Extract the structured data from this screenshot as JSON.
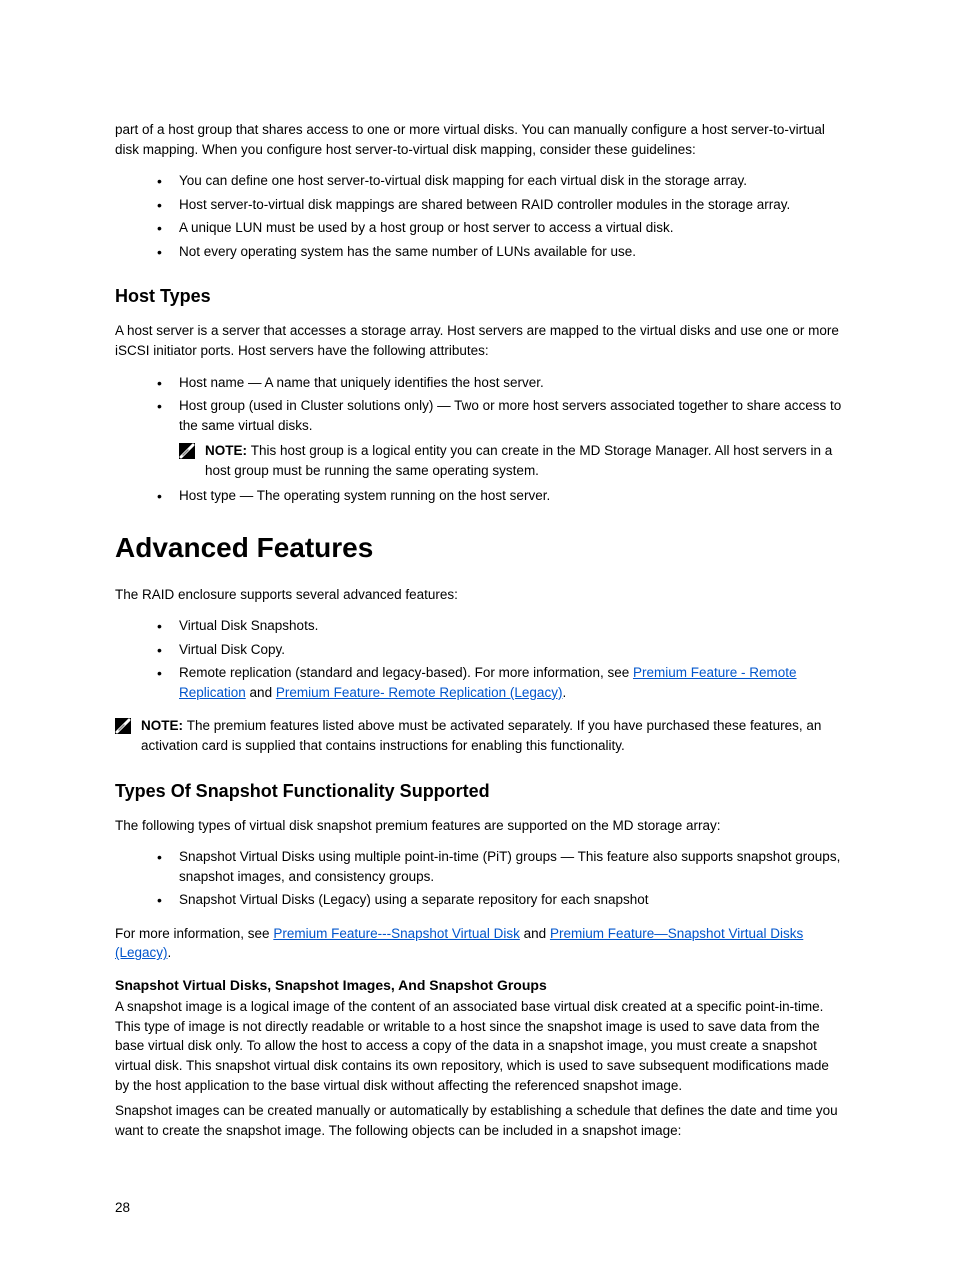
{
  "intro": {
    "para1": "part of a host group that shares access to one or more virtual disks. You can manually configure a host server-to-virtual disk mapping. When you configure host server-to-virtual disk mapping, consider these guidelines:",
    "bullets": [
      "You can define one host server-to-virtual disk mapping for each virtual disk in the storage array.",
      "Host server-to-virtual disk mappings are shared between RAID controller modules in the storage array.",
      "A unique LUN must be used by a host group or host server to access a virtual disk.",
      "Not every operating system has the same number of LUNs available for use."
    ]
  },
  "hostTypes": {
    "heading": "Host Types",
    "para1": "A host server is a server that accesses a storage array. Host servers are mapped to the virtual disks and use one or more iSCSI initiator ports. Host servers have the following attributes:",
    "bullet1": "Host name — A name that uniquely identifies the host server.",
    "bullet2": "Host group (used in Cluster solutions only) — Two or more host servers associated together to share access to the same virtual disks.",
    "noteLabel": "NOTE: ",
    "noteText": "This host group is a logical entity you can create in the MD Storage Manager. All host servers in a host group must be running the same operating system.",
    "bullet3": "Host type — The operating system running on the host server."
  },
  "advancedFeatures": {
    "heading": "Advanced Features",
    "para1": "The RAID enclosure supports several advanced features:",
    "bullet1": "Virtual Disk Snapshots.",
    "bullet2": "Virtual Disk Copy.",
    "bullet3_pre": "Remote replication (standard and legacy-based). For more information, see ",
    "bullet3_link1": "Premium Feature - Remote Replication",
    "bullet3_mid": " and ",
    "bullet3_link2": "Premium Feature- Remote Replication (Legacy)",
    "bullet3_end": ".",
    "noteLabel": "NOTE: ",
    "noteText": "The premium features listed above must be activated separately. If you have purchased these features, an activation card is supplied that contains instructions for enabling this functionality."
  },
  "snapshotTypes": {
    "heading": "Types Of Snapshot Functionality Supported",
    "para1": "The following types of virtual disk snapshot premium features are supported on the MD storage array:",
    "bullet1": "Snapshot Virtual Disks using multiple point-in-time (PiT) groups — This feature also supports snapshot groups, snapshot images, and consistency groups.",
    "bullet2": "Snapshot Virtual Disks (Legacy) using a separate repository for each snapshot",
    "para2_pre": "For more information, see ",
    "para2_link1": "Premium Feature---Snapshot Virtual Disk",
    "para2_mid": " and ",
    "para2_link2": "Premium Feature—Snapshot Virtual Disks (Legacy)",
    "para2_end": "."
  },
  "snapshotDisks": {
    "heading": "Snapshot Virtual Disks, Snapshot Images, And Snapshot Groups",
    "para1": "A snapshot image is a logical image of the content of an associated base virtual disk created at a specific point-in-time. This type of image is not directly readable or writable to a host since the snapshot image is used to save data from the base virtual disk only. To allow the host to access a copy of the data in a snapshot image, you must create a snapshot virtual disk. This snapshot virtual disk contains its own repository, which is used to save subsequent modifications made by the host application to the base virtual disk without affecting the referenced snapshot image.",
    "para2": "Snapshot images can be created manually or automatically by establishing a schedule that defines the date and time you want to create the snapshot image. The following objects can be included in a snapshot image:"
  },
  "pageNumber": "28"
}
